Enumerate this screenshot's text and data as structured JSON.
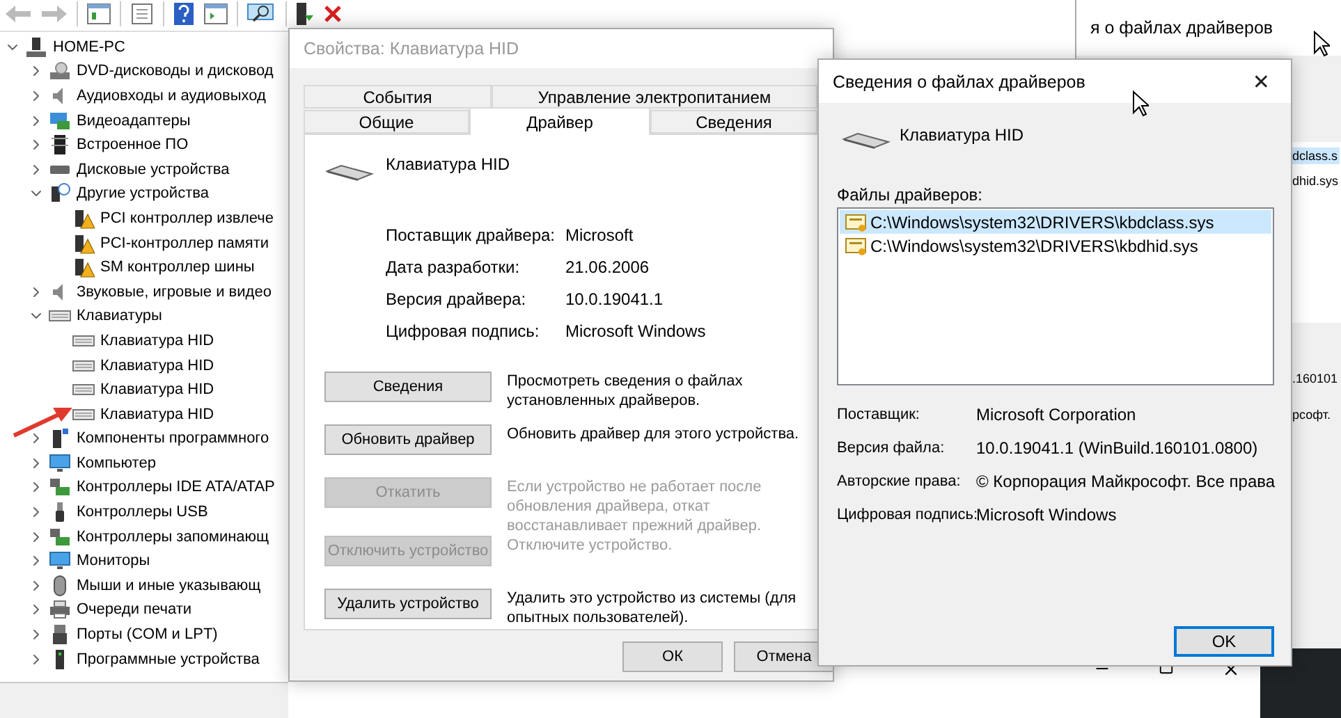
{
  "device_manager": {
    "tree": {
      "label": "HOME-PC",
      "expanded": true,
      "children": [
        {
          "label": "DVD-дисководы и дисковод",
          "expanded": false
        },
        {
          "label": "Аудиовходы и аудиовыход",
          "expanded": false
        },
        {
          "label": "Видеоадаптеры",
          "expanded": false
        },
        {
          "label": "Встроенное ПО",
          "expanded": false
        },
        {
          "label": "Дисковые устройства",
          "expanded": false
        },
        {
          "label": "Другие устройства",
          "expanded": true,
          "children": [
            {
              "label": "PCI контроллер извлече"
            },
            {
              "label": "PCI-контроллер памяти"
            },
            {
              "label": "SM контроллер шины"
            }
          ]
        },
        {
          "label": "Звуковые, игровые и видео",
          "expanded": false
        },
        {
          "label": "Клавиатуры",
          "expanded": true,
          "children": [
            {
              "label": "Клавиатура HID"
            },
            {
              "label": "Клавиатура HID"
            },
            {
              "label": "Клавиатура HID"
            },
            {
              "label": "Клавиатура HID"
            }
          ]
        },
        {
          "label": "Компоненты программного",
          "expanded": false
        },
        {
          "label": "Компьютер",
          "expanded": false
        },
        {
          "label": "Контроллеры IDE ATA/ATAP",
          "expanded": false
        },
        {
          "label": "Контроллеры USB",
          "expanded": false
        },
        {
          "label": "Контроллеры запоминающ",
          "expanded": false
        },
        {
          "label": "Мониторы",
          "expanded": false
        },
        {
          "label": "Мыши и иные указывающ",
          "expanded": false
        },
        {
          "label": "Очереди печати",
          "expanded": false
        },
        {
          "label": "Порты (COM и LPT)",
          "expanded": false
        },
        {
          "label": "Программные устройства",
          "expanded": false
        }
      ]
    }
  },
  "properties_dialog": {
    "title": "Свойства: Клавиатура HID",
    "tab_rows": [
      {
        "tabs": [
          {
            "label": "События",
            "selected": false
          },
          {
            "label": "Управление электропитанием",
            "selected": false
          }
        ]
      },
      {
        "tabs": [
          {
            "label": "Общие",
            "selected": false
          },
          {
            "label": "Драйвер",
            "selected": true
          },
          {
            "label": "Сведения",
            "selected": false
          }
        ]
      }
    ],
    "device_name": "Клавиатура HID",
    "properties": [
      {
        "label": "Поставщик драйвера:",
        "value": "Microsoft"
      },
      {
        "label": "Дата разработки:",
        "value": "21.06.2006"
      },
      {
        "label": "Версия драйвера:",
        "value": "10.0.19041.1"
      },
      {
        "label": "Цифровая подпись:",
        "value": "Microsoft Windows"
      }
    ],
    "actions": [
      {
        "button": "Сведения",
        "description": "Просмотреть сведения о файлах установленных драйверов.",
        "disabled": false
      },
      {
        "button": "Обновить драйвер",
        "description": "Обновить драйвер для этого устройства.",
        "disabled": false
      },
      {
        "button": "Откатить",
        "description": "Если устройство не работает после обновления драйвера, откат восстанавливает прежний драйвер.",
        "disabled": true
      },
      {
        "button": "Отключить устройство",
        "description": "Отключите устройство.",
        "disabled": true
      },
      {
        "button": "Удалить устройство",
        "description": "Удалить это устройство из системы (для опытных пользователей).",
        "disabled": false
      }
    ],
    "buttons": [
      "ОК",
      "Отмена"
    ]
  },
  "driver_files_dialog": {
    "title": "Сведения о файлах драйверов",
    "close": "✕",
    "device_name": "Клавиатура HID",
    "files_label": "Файлы драйверов:",
    "files": [
      {
        "path": "C:\\Windows\\system32\\DRIVERS\\kbdclass.sys",
        "selected": true
      },
      {
        "path": "C:\\Windows\\system32\\DRIVERS\\kbdhid.sys",
        "selected": false
      }
    ],
    "properties": [
      {
        "label": "Поставщик:",
        "value": "Microsoft Corporation"
      },
      {
        "label": "Версия файла:",
        "value": "10.0.19041.1 (WinBuild.160101.0800)"
      },
      {
        "label": "Авторские права:",
        "value": "© Корпорация Майкрософт. Все права"
      },
      {
        "label": "Цифровая подпись:",
        "value": "Microsoft Windows"
      }
    ],
    "ok": "OK"
  },
  "background_window": {
    "title": "я о файлах драйверов",
    "list_fragments": [
      {
        "text": "dclass.s",
        "selected": true
      },
      {
        "text": "dhid.sys",
        "selected": false
      }
    ],
    "detail_fragments": [
      ".160101",
      "рсофт."
    ]
  }
}
